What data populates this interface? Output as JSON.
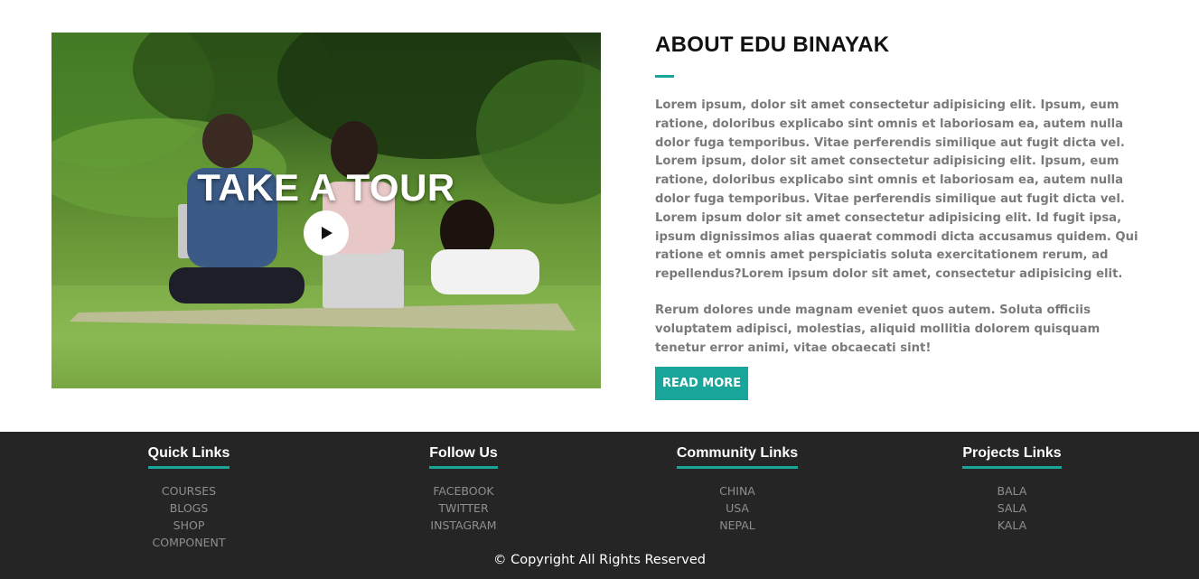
{
  "about": {
    "video": {
      "title": "TAKE A TOUR",
      "play_icon": "play-icon"
    },
    "heading": "ABOUT EDU BINAYAK",
    "paragraphs": [
      "Lorem ipsum, dolor sit amet consectetur adipisicing elit. Ipsum, eum ratione, doloribus explicabo sint omnis et laboriosam ea, autem nulla dolor fuga temporibus. Vitae perferendis similique aut fugit dicta vel. Lorem ipsum, dolor sit amet consectetur adipisicing elit. Ipsum, eum ratione, doloribus explicabo sint omnis et laboriosam ea, autem nulla dolor fuga temporibus. Vitae perferendis similique aut fugit dicta vel. Lorem ipsum dolor sit amet consectetur adipisicing elit. Id fugit ipsa, ipsum dignissimos alias quaerat commodi dicta accusamus quidem. Qui ratione et omnis amet perspiciatis soluta exercitationem rerum, ad repellendus?Lorem ipsum dolor sit amet, consectetur adipisicing elit.",
      "Rerum dolores unde magnam eveniet quos autem. Soluta officiis voluptatem adipisci, molestias, aliquid mollitia dolorem quisquam tenetur error animi, vitae obcaecati sint!"
    ],
    "read_more_label": "READ MORE"
  },
  "footer": {
    "columns": [
      {
        "title": "Quick Links",
        "items": [
          "COURSES",
          "BLOGS",
          "SHOP",
          "COMPONENT"
        ]
      },
      {
        "title": "Follow Us",
        "items": [
          "FACEBOOK",
          "TWITTER",
          "INSTAGRAM"
        ]
      },
      {
        "title": "Community Links",
        "items": [
          "CHINA",
          "USA",
          "NEPAL"
        ]
      },
      {
        "title": "Projects Links",
        "items": [
          "BALA",
          "SALA",
          "KALA"
        ]
      }
    ],
    "copyright": "© Copyright All Rights Reserved"
  },
  "colors": {
    "accent": "#1aa59a",
    "footer_bg": "#252525",
    "body_text": "#7a7a7a"
  }
}
